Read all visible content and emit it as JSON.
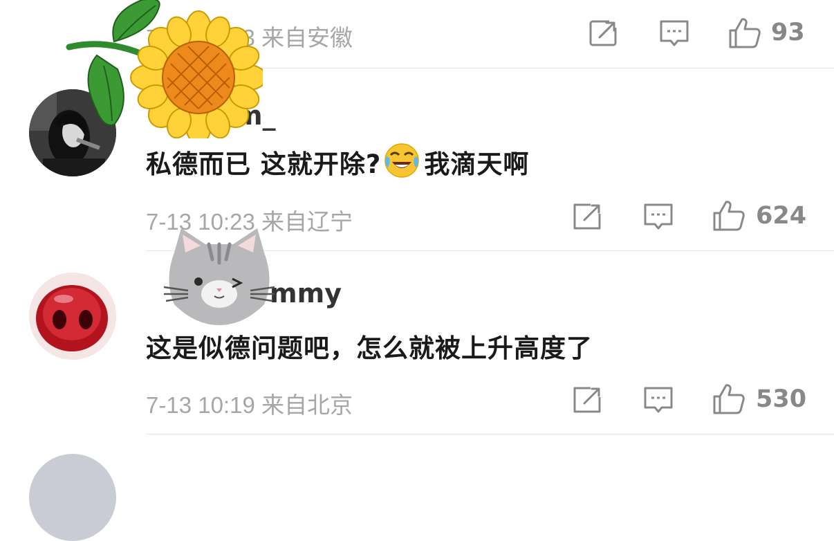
{
  "comments": [
    {
      "username": "",
      "text": "",
      "meta": "7-13 10:23 来自安徽",
      "likes": "93"
    },
    {
      "username": "m_",
      "text_before_emoji": "私德而已 这就开除?",
      "emoji": "laughing-crying-emoji",
      "text_after_emoji": "我滴天啊",
      "meta": "7-13 10:23 来自辽宁",
      "likes": "624"
    },
    {
      "username": "mmy",
      "text": "这是似德问题吧，怎么就被上升高度了",
      "meta": "7-13 10:19 来自北京",
      "likes": "530"
    }
  ],
  "icons": {
    "share": "share-icon",
    "reply": "comment-icon",
    "like": "thumbs-up-icon"
  },
  "colors": {
    "meta_text": "#a6a6a6",
    "icon_stroke": "#888888",
    "divider": "#e6e6e6"
  }
}
